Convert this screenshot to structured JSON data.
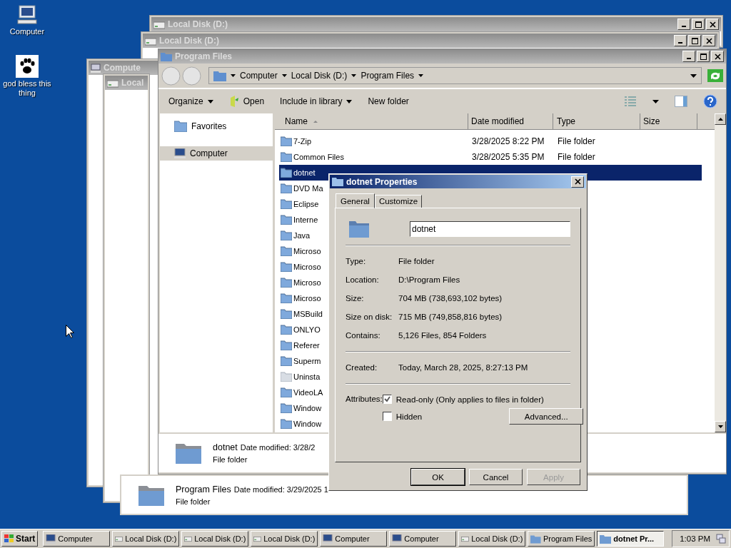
{
  "desktop_icons": [
    {
      "label": "Computer",
      "kind": "computer"
    },
    {
      "label": "god bless this thing",
      "kind": "paw"
    }
  ],
  "background_windows": [
    {
      "title": "Local Disk (D:)",
      "kind": "disk"
    },
    {
      "title": "Local Disk (D:)",
      "kind": "disk"
    },
    {
      "title": "Compute",
      "kind": "computer"
    },
    {
      "title": "Local",
      "kind": "disk"
    }
  ],
  "back_details": {
    "name": "Program Files",
    "date": "Date modified: 3/29/2025 1",
    "type": "File folder"
  },
  "explorer": {
    "title": "Program Files",
    "breadcrumb": [
      "Computer",
      "Local Disk (D:)",
      "Program Files"
    ],
    "toolbar": [
      {
        "label": "Organize",
        "kind": "menu"
      },
      {
        "label": "Open",
        "kind": "open"
      },
      {
        "label": "Include in library",
        "kind": "menu"
      },
      {
        "label": "New folder",
        "kind": "plain"
      }
    ],
    "nav": [
      {
        "label": "Favorites",
        "kind": "folder",
        "selected": false
      },
      {
        "label": "Computer",
        "kind": "computer",
        "selected": true
      }
    ],
    "columns": [
      "Name",
      "Date modified",
      "Type",
      "Size"
    ],
    "rows": [
      {
        "name": "7-Zip",
        "date": "3/28/2025 8:22 PM",
        "type": "File folder",
        "selected": false,
        "kind": "folder"
      },
      {
        "name": "Common Files",
        "date": "3/28/2025 5:35 PM",
        "type": "File folder",
        "selected": false,
        "kind": "folder"
      },
      {
        "name": "dotnet",
        "selected": true,
        "kind": "folder"
      },
      {
        "name": "DVD Ma",
        "selected": false,
        "kind": "folder"
      },
      {
        "name": "Eclipse",
        "selected": false,
        "kind": "folder"
      },
      {
        "name": "Interne",
        "selected": false,
        "kind": "folder"
      },
      {
        "name": "Java",
        "selected": false,
        "kind": "folder"
      },
      {
        "name": "Microso",
        "selected": false,
        "kind": "folder"
      },
      {
        "name": "Microso",
        "selected": false,
        "kind": "folder"
      },
      {
        "name": "Microso",
        "selected": false,
        "kind": "folder"
      },
      {
        "name": "Microso",
        "selected": false,
        "kind": "folder"
      },
      {
        "name": "MSBuild",
        "selected": false,
        "kind": "folder"
      },
      {
        "name": "ONLYO",
        "selected": false,
        "kind": "folder"
      },
      {
        "name": "Referer",
        "selected": false,
        "kind": "folder"
      },
      {
        "name": "Superm",
        "selected": false,
        "kind": "folder"
      },
      {
        "name": "Uninsta",
        "selected": false,
        "kind": "faded"
      },
      {
        "name": "VideoLA",
        "selected": false,
        "kind": "folder"
      },
      {
        "name": "Window",
        "selected": false,
        "kind": "folder"
      },
      {
        "name": "Window",
        "selected": false,
        "kind": "folder"
      }
    ],
    "details": {
      "name": "dotnet",
      "date": "Date modified: 3/28/2",
      "type": "File folder"
    }
  },
  "dialog": {
    "title": "dotnet Properties",
    "tabs": [
      {
        "label": "General",
        "selected": true
      },
      {
        "label": "Customize",
        "selected": false
      }
    ],
    "name_value": "dotnet",
    "props": [
      {
        "label": "Type:",
        "value": "File folder"
      },
      {
        "label": "Location:",
        "value": "D:\\Program Files"
      },
      {
        "label": "Size:",
        "value": "704 MB (738,693,102 bytes)"
      },
      {
        "label": "Size on disk:",
        "value": "715 MB (749,858,816 bytes)"
      },
      {
        "label": "Contains:",
        "value": "5,126 Files, 854 Folders"
      }
    ],
    "created": {
      "label": "Created:",
      "value": "Today, March 28, 2025, 8:27:13 PM"
    },
    "attributes_label": "Attributes:",
    "attributes": [
      {
        "label": "Read-only (Only applies to files in folder)",
        "checked": true
      },
      {
        "label": "Hidden",
        "checked": false
      }
    ],
    "advanced": "Advanced...",
    "buttons": [
      {
        "label": "OK",
        "disabled": false
      },
      {
        "label": "Cancel",
        "disabled": false
      },
      {
        "label": "Apply",
        "disabled": true
      }
    ]
  },
  "taskbar": {
    "start": "Start",
    "items": [
      {
        "label": "Computer",
        "kind": "computer",
        "selected": false
      },
      {
        "label": "Local Disk (D:)",
        "kind": "disk",
        "selected": false
      },
      {
        "label": "Local Disk (D:)",
        "kind": "disk",
        "selected": false
      },
      {
        "label": "Local Disk (D:)",
        "kind": "disk",
        "selected": false
      },
      {
        "label": "Computer",
        "kind": "computer",
        "selected": false
      },
      {
        "label": "Computer",
        "kind": "computer",
        "selected": false
      },
      {
        "label": "Local Disk (D:)",
        "kind": "disk",
        "selected": false
      },
      {
        "label": "Program Files",
        "kind": "folder",
        "selected": false
      },
      {
        "label": "dotnet Pr...",
        "kind": "folder",
        "selected": true
      }
    ],
    "clock": "1:03 PM"
  }
}
